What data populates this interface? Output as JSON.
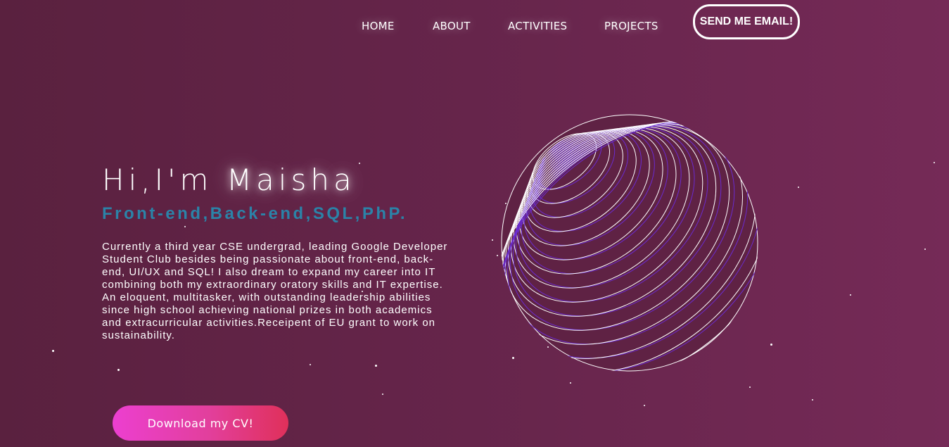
{
  "nav": {
    "home": "HOME",
    "about": "ABOUT",
    "activities": "ACTIVITIES",
    "projects": "PROJECTS",
    "email_button": "SEND ME EMAIL!"
  },
  "hero": {
    "title_prefix": "Hi,I'm ",
    "title_name": "Maisha",
    "subtitle": "Front-end,Back-end,SQL,PhP.",
    "description": "Currently a third year CSE undergrad, leading Google Developer Student Club besides being passionate about front-end, back-end, UI/UX and SQL! I also dream to expand my career into IT combining both my extraordinary oratory skills and IT expertise. An eloquent, multitasker, with outstanding leadership abilities since high school achieving national prizes in both academics and extracurricular activities.Receipent of EU grant to work on sustainability.",
    "cv_button": "Download my CV!"
  },
  "colors": {
    "background_start": "#5a213f",
    "background_end": "#752a57",
    "subtitle": "#2b83a8",
    "cv_button_start": "#ec3fd0",
    "cv_button_end": "#e0305a",
    "sphere_line": "#ffffff",
    "sphere_accent": "#6a2bd0"
  },
  "icons": {
    "sphere": "striped-globe-graphic"
  }
}
